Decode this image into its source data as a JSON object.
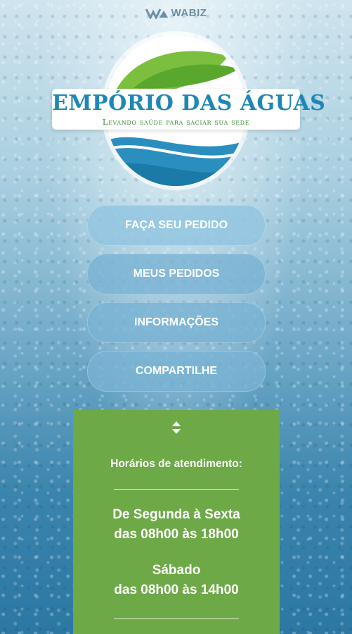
{
  "brand": {
    "wabiz_label": "WABIZ",
    "app_title": "Empório das Águas",
    "tagline": "Levando saúde para saciar sua sede"
  },
  "menu": {
    "items": [
      {
        "label": "FAÇA SEU PEDIDO"
      },
      {
        "label": "MEUS PEDIDOS"
      },
      {
        "label": "INFORMAÇÕES"
      },
      {
        "label": "COMPARTILHE"
      }
    ]
  },
  "hours": {
    "toggle_icon": "up-down-arrows-icon",
    "title": "Horários de atendimento:",
    "weekday_label": "De Segunda à Sexta",
    "weekday_hours": "das 08h00 às 18h00",
    "saturday_label": "Sábado",
    "saturday_hours": "das 08h00 às 14h00"
  },
  "colors": {
    "brand_blue": "#1f87b5",
    "brand_green": "#6ea948",
    "button_blue": "#78b2d4"
  }
}
